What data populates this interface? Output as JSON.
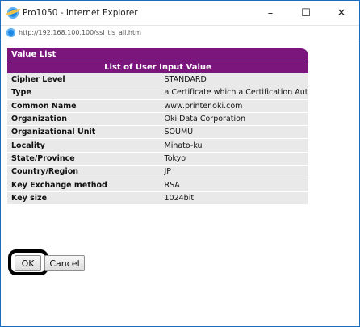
{
  "window": {
    "title": "Pro1050 - Internet Explorer",
    "minimize_glyph": "–",
    "maximize_glyph": "☐",
    "close_glyph": "✕"
  },
  "address": {
    "url": "http://192.168.100.100/ssl_tls_all.htm"
  },
  "panel": {
    "title": "Value List",
    "table_heading": "List of User Input Value",
    "rows": [
      {
        "label": "Cipher Level",
        "value": "STANDARD"
      },
      {
        "label": "Type",
        "value": "a Certificate which a Certification Authority signed"
      },
      {
        "label": "Common Name",
        "value": "www.printer.oki.com"
      },
      {
        "label": "Organization",
        "value": "Oki Data Corporation"
      },
      {
        "label": "Organizational Unit",
        "value": "SOUMU"
      },
      {
        "label": "Locality",
        "value": "Minato-ku"
      },
      {
        "label": "State/Province",
        "value": "Tokyo"
      },
      {
        "label": "Country/Region",
        "value": "JP"
      },
      {
        "label": "Key Exchange method",
        "value": "RSA"
      },
      {
        "label": "Key size",
        "value": "1024bit"
      }
    ]
  },
  "buttons": {
    "ok_label": "OK",
    "cancel_label": "Cancel"
  },
  "colors": {
    "accent": "#7b167c",
    "row_background": "#e9e9e9",
    "window_border": "#1c6bbd"
  },
  "icons": [
    "internet-explorer-icon",
    "minimize-icon",
    "maximize-icon",
    "close-icon"
  ]
}
